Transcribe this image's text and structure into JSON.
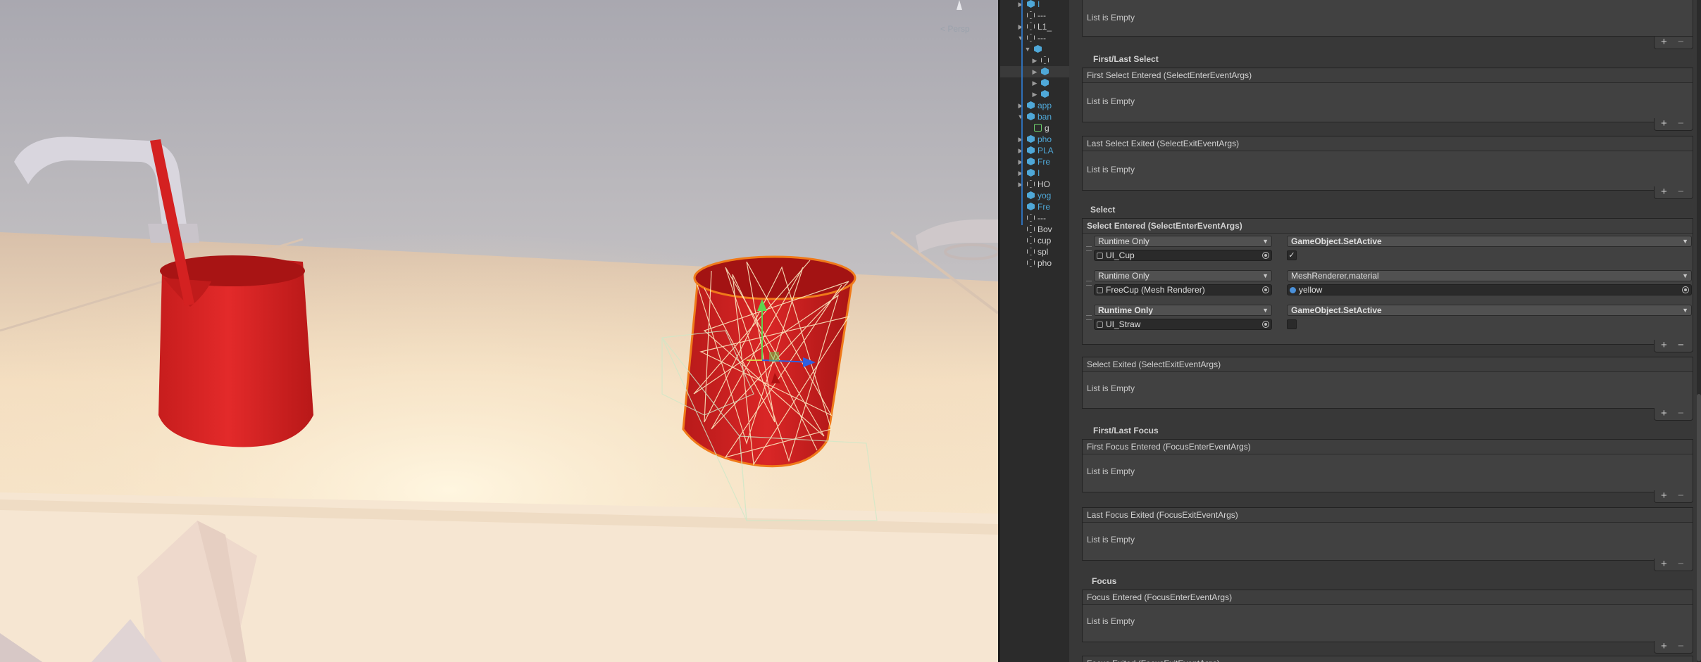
{
  "scene": {
    "projection_label": "< Persp"
  },
  "hierarchy": {
    "items": [
      {
        "name": "I",
        "icon": "cube-blue",
        "arrow": "▶",
        "blue": true
      },
      {
        "name": "---",
        "icon": "cube-gray",
        "arrow": "",
        "blue": false
      },
      {
        "name": "L1_",
        "icon": "cube-gray",
        "arrow": "▶",
        "blue": false
      },
      {
        "name": "---",
        "icon": "cube-gray",
        "arrow": "▼",
        "blue": false
      },
      {
        "name": "",
        "icon": "cube-blue",
        "arrow": "▼",
        "blue": true
      },
      {
        "name": "",
        "icon": "cube-gray",
        "arrow": "▶",
        "blue": false
      },
      {
        "name": "",
        "icon": "cube-blue",
        "arrow": "▶",
        "blue": true
      },
      {
        "name": "",
        "icon": "cube-blue",
        "arrow": "▶",
        "blue": true
      },
      {
        "name": "",
        "icon": "cube-blue",
        "arrow": "▶",
        "blue": true
      },
      {
        "name": "app",
        "icon": "cube-blue",
        "arrow": "▶",
        "blue": true
      },
      {
        "name": "ban",
        "icon": "cube-blue",
        "arrow": "▼",
        "blue": true
      },
      {
        "name": "g",
        "icon": "cube-green",
        "arrow": "",
        "blue": false
      },
      {
        "name": "pho",
        "icon": "cube-blue",
        "arrow": "▶",
        "blue": true
      },
      {
        "name": "PLA",
        "icon": "cube-blue",
        "arrow": "▶",
        "blue": true
      },
      {
        "name": "Fre",
        "icon": "cube-blue",
        "arrow": "▶",
        "blue": true
      },
      {
        "name": "I",
        "icon": "cube-blue",
        "arrow": "▶",
        "blue": true
      },
      {
        "name": "HO",
        "icon": "cube-gray",
        "arrow": "▶",
        "blue": false
      },
      {
        "name": "yog",
        "icon": "cube-blue",
        "arrow": "",
        "blue": true
      },
      {
        "name": "Fre",
        "icon": "cube-blue",
        "arrow": "",
        "blue": true
      },
      {
        "name": "---",
        "icon": "cube-gray",
        "arrow": "",
        "blue": false
      },
      {
        "name": "Bov",
        "icon": "cube-gray",
        "arrow": "",
        "blue": false
      },
      {
        "name": "cup",
        "icon": "cube-gray",
        "arrow": "",
        "blue": false
      },
      {
        "name": "spl",
        "icon": "cube-gray",
        "arrow": "",
        "blue": false
      },
      {
        "name": "pho",
        "icon": "cube-gray",
        "arrow": "",
        "blue": false
      }
    ]
  },
  "inspector": {
    "list_empty": "List is Empty",
    "sections": {
      "first_last_select": "First/Last Select",
      "select": "Select",
      "first_last_focus": "First/Last Focus",
      "focus": "Focus"
    },
    "events": {
      "first_select_entered": "First Select Entered (SelectEnterEventArgs)",
      "last_select_exited": "Last Select Exited (SelectExitEventArgs)",
      "select_entered": "Select Entered (SelectEnterEventArgs)",
      "select_exited": "Select Exited (SelectExitEventArgs)",
      "first_focus_entered": "First Focus Entered (FocusEnterEventArgs)",
      "last_focus_exited": "Last Focus Exited (FocusExitEventArgs)",
      "focus_entered": "Focus Entered (FocusEnterEventArgs)",
      "focus_exited": "Focus Exited (FocusExitEventArgs)"
    },
    "select_entries": [
      {
        "mode": "Runtime Only",
        "target": "UI_Cup",
        "function": "GameObject.SetActive",
        "value_type": "checkbox",
        "checked": true,
        "value": "",
        "mode_bold": false,
        "func_bold": true
      },
      {
        "mode": "Runtime Only",
        "target": "FreeCup (Mesh Renderer)",
        "function": "MeshRenderer.material",
        "value_type": "object",
        "checked": false,
        "value": "yellow",
        "mode_bold": false,
        "func_bold": false
      },
      {
        "mode": "Runtime Only",
        "target": "UI_Straw",
        "function": "GameObject.SetActive",
        "value_type": "checkbox",
        "checked": false,
        "value": "",
        "mode_bold": true,
        "func_bold": true
      }
    ],
    "plus": "+",
    "minus": "−",
    "checkmark": "✓",
    "caret": "▼"
  }
}
